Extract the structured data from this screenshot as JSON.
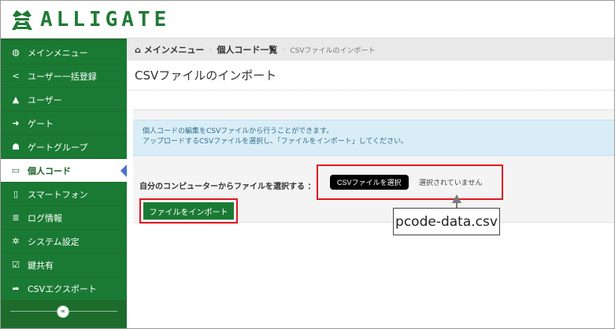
{
  "brand": {
    "name": "ALLIGATE",
    "logo_icon": "alligator-logo-icon",
    "color": "#1f7a35"
  },
  "sidebar": {
    "items": [
      {
        "label": "メインメニュー",
        "icon": "dashboard-icon",
        "glyph": "◍"
      },
      {
        "label": "ユーザー一括登録",
        "icon": "share-icon",
        "glyph": "<"
      },
      {
        "label": "ユーザー",
        "icon": "user-icon",
        "glyph": "▲"
      },
      {
        "label": "ゲート",
        "icon": "sign-in-icon",
        "glyph": "➜"
      },
      {
        "label": "ゲートグループ",
        "icon": "group-icon",
        "glyph": "☗"
      },
      {
        "label": "個人コード",
        "icon": "card-icon",
        "glyph": "▭",
        "active": true
      },
      {
        "label": "スマートフォン",
        "icon": "phone-icon",
        "glyph": "▯"
      },
      {
        "label": "ログ情報",
        "icon": "list-icon",
        "glyph": "≣"
      },
      {
        "label": "システム設定",
        "icon": "cog-icon",
        "glyph": "✲"
      },
      {
        "label": "鍵共有",
        "icon": "check-square-icon",
        "glyph": "☑"
      },
      {
        "label": "CSVエクスポート",
        "icon": "export-arrow-icon",
        "glyph": "➦"
      }
    ],
    "collapse_glyph": "«"
  },
  "breadcrumb": {
    "home_glyph": "⌂",
    "home": "メインメニュー",
    "middle": "個人コード一覧",
    "current": "CSVファイルのインポート",
    "separator": "›"
  },
  "page": {
    "title": "CSVファイルのインポート",
    "info_line1": "個人コードの編集をCSVファイルから行うことができます。",
    "info_line2": "アップロードするCSVファイルを選択し、「ファイルをインポート」してください。",
    "file_label": "自分のコンピューターからファイルを選択する ：",
    "file_button": "CSVファイルを選択",
    "file_status": "選択されていません",
    "import_button": "ファイルをインポート"
  },
  "annotation": {
    "callout_text": "pcode-data.csv"
  },
  "colors": {
    "sidebar_bg": "#1a7a33",
    "highlight": "#e0161e",
    "info_bg": "#d9edf7"
  }
}
